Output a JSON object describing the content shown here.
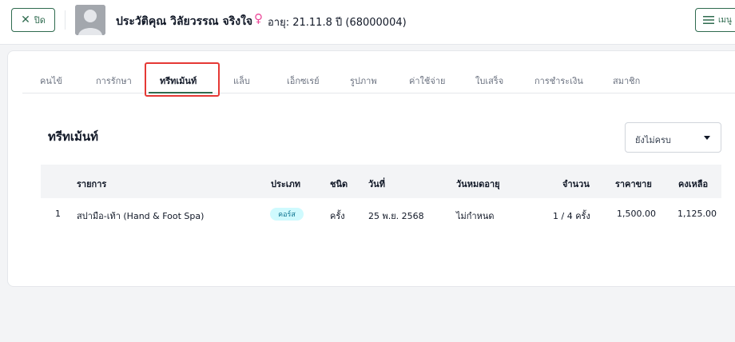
{
  "header": {
    "close_label": "ปิด",
    "patient_name": "ประวัติคุณ วิลัยวรรณ จริงใจ",
    "age_info": "อายุ: 21.11.8 ปี (68000004)",
    "menu_label": "เมนู"
  },
  "tabs": [
    {
      "label": "คนไข้"
    },
    {
      "label": "การรักษา"
    },
    {
      "label": "ทรีทเม้นท์"
    },
    {
      "label": "แล็บ"
    },
    {
      "label": "เอ็กซเรย์"
    },
    {
      "label": "รูปภาพ"
    },
    {
      "label": "ค่าใช้จ่าย"
    },
    {
      "label": "ใบเสร็จ"
    },
    {
      "label": "การชำระเงิน"
    },
    {
      "label": "สมาชิก"
    }
  ],
  "section": {
    "title": "ทรีทเม้นท์",
    "filter_value": "ยังไม่ครบ"
  },
  "table": {
    "headers": {
      "item": "รายการ",
      "category": "ประเภท",
      "unit": "ชนิด",
      "date": "วันที่",
      "expiry": "วันหมดอายุ",
      "quantity": "จำนวน",
      "price": "ราคาขาย",
      "balance": "คงเหลือ"
    },
    "rows": [
      {
        "no": "1",
        "item": "สปามือ-เท้า (Hand & Foot Spa)",
        "category": "คอร์ส",
        "unit": "ครั้ง",
        "date": "25 พ.ย. 2568",
        "expiry": "ไม่กำหนด",
        "quantity": "1 / 4 ครั้ง",
        "price": "1,500.00",
        "balance": "1,125.00"
      }
    ]
  },
  "colors": {
    "brand": "#2f6b4f",
    "badge_bg": "#cffafe",
    "highlight": "#e53935",
    "female": "#ec4899"
  }
}
